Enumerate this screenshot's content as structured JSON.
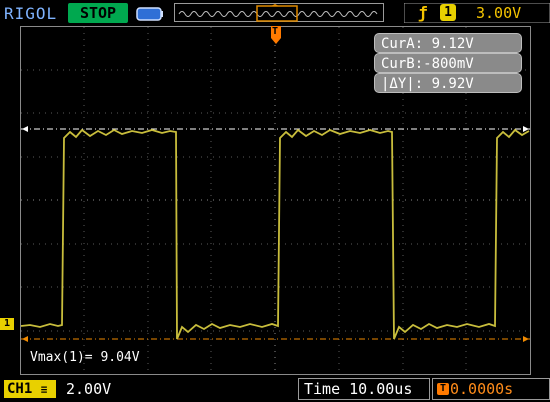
{
  "header": {
    "brand": "RIGOL",
    "run_state": "STOP",
    "trigger": {
      "edge_icon": "rising-edge-icon",
      "source": "1",
      "level": "3.00V"
    }
  },
  "trigger_marker": {
    "label": "T"
  },
  "channel_marker": {
    "label": "1"
  },
  "cursors": {
    "a": "CurA:  9.12V",
    "b": "CurB:-800mV",
    "delta": "|ΔY|:  9.92V"
  },
  "measurement": "Vmax(1)= 9.04V",
  "footer": {
    "ch_label": "CH1",
    "ch_scale": "2.00V",
    "timebase": "Time 10.00us",
    "offset": "0.0000s",
    "offset_icon": "trigger-offset-icon"
  },
  "colors": {
    "trace": "#c8bd3c",
    "cursor_a": "#ffffff",
    "cursor_b": "#f08a00",
    "grid": "#6a6a6a",
    "status_green": "#00a84f",
    "channel_yellow": "#e8d000"
  }
}
